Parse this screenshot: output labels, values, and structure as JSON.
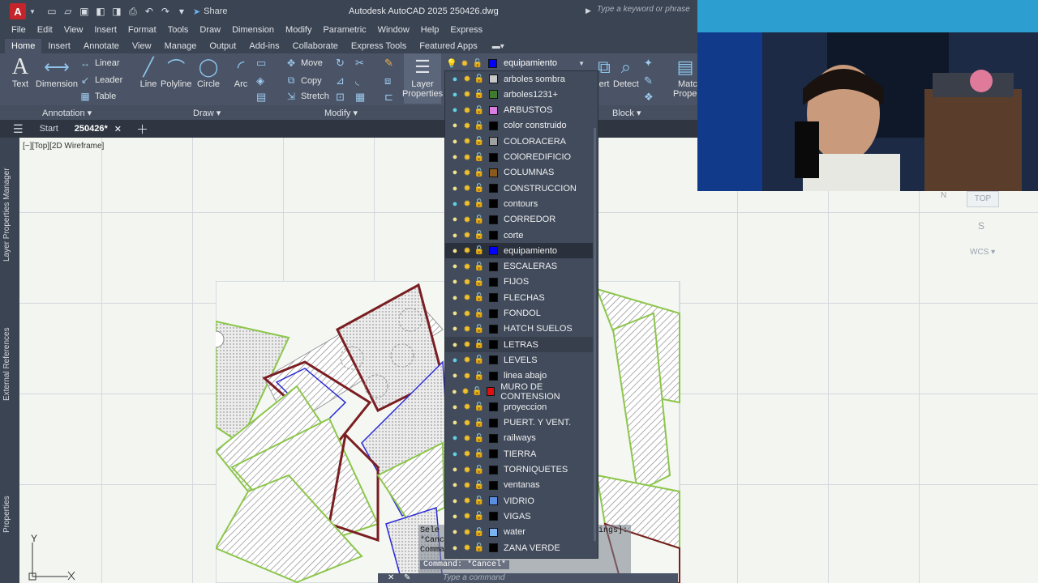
{
  "title": "Autodesk AutoCAD 2025    250426.dwg",
  "search_placeholder": "Type a keyword or phrase",
  "share_label": "Share",
  "menu": [
    "File",
    "Edit",
    "View",
    "Insert",
    "Format",
    "Tools",
    "Draw",
    "Dimension",
    "Modify",
    "Parametric",
    "Window",
    "Help",
    "Express"
  ],
  "ribbon_tabs": [
    "Home",
    "Insert",
    "Annotate",
    "View",
    "Manage",
    "Output",
    "Add-ins",
    "Collaborate",
    "Express Tools",
    "Featured Apps"
  ],
  "annotation": {
    "text": "Text",
    "dimension": "Dimension",
    "linear": "Linear",
    "leader": "Leader",
    "table": "Table",
    "panel": "Annotation"
  },
  "draw": {
    "line": "Line",
    "polyline": "Polyline",
    "circle": "Circle",
    "arc": "Arc",
    "panel": "Draw"
  },
  "modify": {
    "move": "Move",
    "copy": "Copy",
    "stretch": "Stretch",
    "panel": "Modify"
  },
  "layers": {
    "properties_line1": "Layer",
    "properties_line2": "Properties",
    "current": "equipamiento",
    "current_color": "#0000ff"
  },
  "block": {
    "insert_partial": "ert",
    "detect": "Detect",
    "panel": "Block",
    "match_line1": "Match",
    "match_line2": "Propert"
  },
  "doc_tabs": {
    "start": "Start",
    "file": "250426*"
  },
  "viewport_label": "[−][Top][2D Wireframe]",
  "side_panels": [
    "Layer Properties Manager",
    "External References",
    "Properties"
  ],
  "layer_list": [
    {
      "name": "arboles sombra",
      "color": "#c8c8c8",
      "bulb": "#5fd0e8"
    },
    {
      "name": "arboles1231+",
      "color": "#3f7a2e",
      "bulb": "#5fd0e8"
    },
    {
      "name": "ARBUSTOS",
      "color": "#d87ee0",
      "bulb": "#5fd0e8"
    },
    {
      "name": "color construido",
      "color": "#000000",
      "bulb": "#f2e08a"
    },
    {
      "name": "COLORACERA",
      "color": "#a0a0a0",
      "bulb": "#f2e08a"
    },
    {
      "name": "COlOREDIFICIO",
      "color": "#000000",
      "bulb": "#f2e08a"
    },
    {
      "name": "COLUMNAS",
      "color": "#8a5a1e",
      "bulb": "#f2e08a"
    },
    {
      "name": "CONSTRUCCION",
      "color": "#000000",
      "bulb": "#f2e08a"
    },
    {
      "name": "contours",
      "color": "#000000",
      "bulb": "#5fd0e8"
    },
    {
      "name": "CORREDOR",
      "color": "#000000",
      "bulb": "#f2e08a"
    },
    {
      "name": "corte",
      "color": "#000000",
      "bulb": "#f2e08a"
    },
    {
      "name": "equipamiento",
      "color": "#0000ff",
      "bulb": "#f2e08a"
    },
    {
      "name": "ESCALERAS",
      "color": "#000000",
      "bulb": "#f2e08a"
    },
    {
      "name": "FIJOS",
      "color": "#000000",
      "bulb": "#f2e08a"
    },
    {
      "name": "FLECHAS",
      "color": "#000000",
      "bulb": "#f2e08a"
    },
    {
      "name": "FONDOL",
      "color": "#000000",
      "bulb": "#f2e08a"
    },
    {
      "name": "HATCH SUELOS",
      "color": "#000000",
      "bulb": "#f2e08a"
    },
    {
      "name": "LETRAS",
      "color": "#000000",
      "bulb": "#f2e08a"
    },
    {
      "name": "LEVELS",
      "color": "#000000",
      "bulb": "#5fd0e8"
    },
    {
      "name": "linea abajo",
      "color": "#000000",
      "bulb": "#f2e08a"
    },
    {
      "name": "MURO DE CONTENSION",
      "color": "#e01010",
      "bulb": "#f2e08a"
    },
    {
      "name": "proyeccion",
      "color": "#000000",
      "bulb": "#f2e08a"
    },
    {
      "name": "PUERT. Y VENT.",
      "color": "#000000",
      "bulb": "#f2e08a"
    },
    {
      "name": "railways",
      "color": "#000000",
      "bulb": "#5fd0e8"
    },
    {
      "name": "TIERRA",
      "color": "#000000",
      "bulb": "#5fd0e8"
    },
    {
      "name": "TORNIQUETES",
      "color": "#000000",
      "bulb": "#f2e08a"
    },
    {
      "name": "ventanas",
      "color": "#000000",
      "bulb": "#f2e08a"
    },
    {
      "name": "VIDRIO",
      "color": "#5a8ee0",
      "bulb": "#f2e08a"
    },
    {
      "name": "VIGAS",
      "color": "#000000",
      "bulb": "#f2e08a"
    },
    {
      "name": "water",
      "color": "#7ab4f0",
      "bulb": "#f2e08a"
    },
    {
      "name": "ZANA VERDE",
      "color": "#000000",
      "bulb": "#f2e08a"
    }
  ],
  "command_lines": [
    "Sele",
    "*Canc",
    "Comma",
    "Command: *Cancel*"
  ],
  "command_tail": "ings]:",
  "command_placeholder": "Type a command",
  "nav": {
    "top": "TOP",
    "wcs": "WCS",
    "north": "N",
    "s": "S"
  },
  "ucs": {
    "y": "Y"
  }
}
